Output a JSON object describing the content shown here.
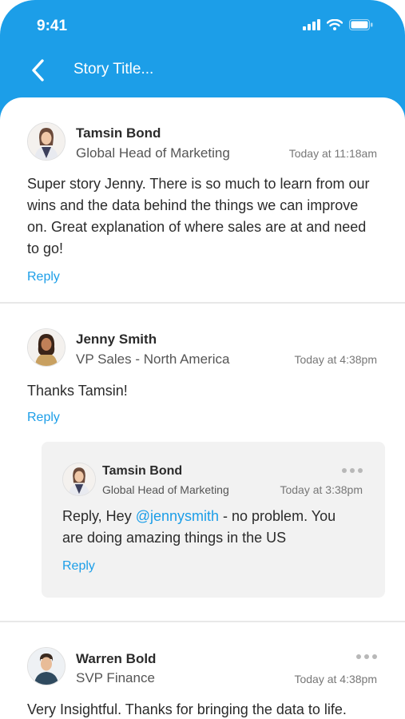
{
  "status_bar": {
    "time": "9:41"
  },
  "nav": {
    "title": "Story Title..."
  },
  "comments": [
    {
      "name": "Tamsin Bond",
      "role": "Global Head of Marketing",
      "timestamp": "Today at 11:18am",
      "text": "Super story Jenny. There is so much to learn from our wins and the data behind the things we can improve on. Great explanation of where sales are at and need to go!",
      "reply_label": "Reply"
    },
    {
      "name": "Jenny Smith",
      "role": "VP Sales - North America",
      "timestamp": "Today at 4:38pm",
      "text": "Thanks Tamsin!",
      "reply_label": "Reply",
      "nested_reply": {
        "name": "Tamsin Bond",
        "role": "Global Head of Marketing",
        "timestamp": "Today at 3:38pm",
        "text_before": "Reply, Hey ",
        "mention": "@jennysmith",
        "text_after": " - no problem. You are doing amazing things in the US",
        "reply_label": "Reply"
      }
    },
    {
      "name": "Warren Bold",
      "role": "SVP Finance",
      "timestamp": "Today at 4:38pm",
      "text": "Very Insightful. Thanks for bringing the data to life."
    }
  ],
  "colors": {
    "accent": "#1c9ee8",
    "nested_bg": "#f2f2f2",
    "divider": "#e8e8e8"
  }
}
